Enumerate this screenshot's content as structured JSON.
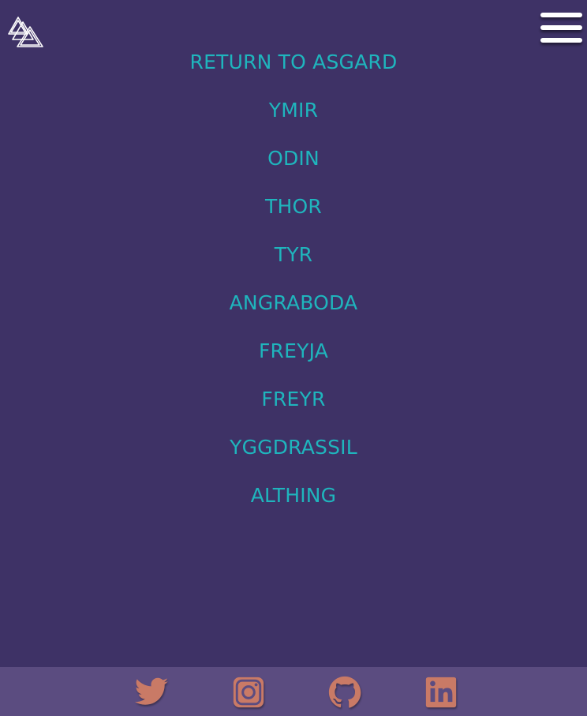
{
  "header": {
    "logo_icon": "valknut-icon",
    "menu_icon": "hamburger-menu-icon"
  },
  "nav": {
    "items": [
      {
        "label": "RETURN TO ASGARD"
      },
      {
        "label": "YMIR"
      },
      {
        "label": "ODIN"
      },
      {
        "label": "THOR"
      },
      {
        "label": "TYR"
      },
      {
        "label": "ANGRABODA"
      },
      {
        "label": "FREYJA"
      },
      {
        "label": "FREYR"
      },
      {
        "label": "YGGDRASSIL"
      },
      {
        "label": "ALTHING"
      }
    ]
  },
  "footer": {
    "icons": [
      "twitter-icon",
      "instagram-icon",
      "github-icon",
      "linkedin-icon"
    ]
  },
  "colors": {
    "background": "#3e3266",
    "footer_background": "#5b4c80",
    "link": "#1fb5bd",
    "social_icon": "#c97a66",
    "menu_bars": "#ffffff"
  }
}
